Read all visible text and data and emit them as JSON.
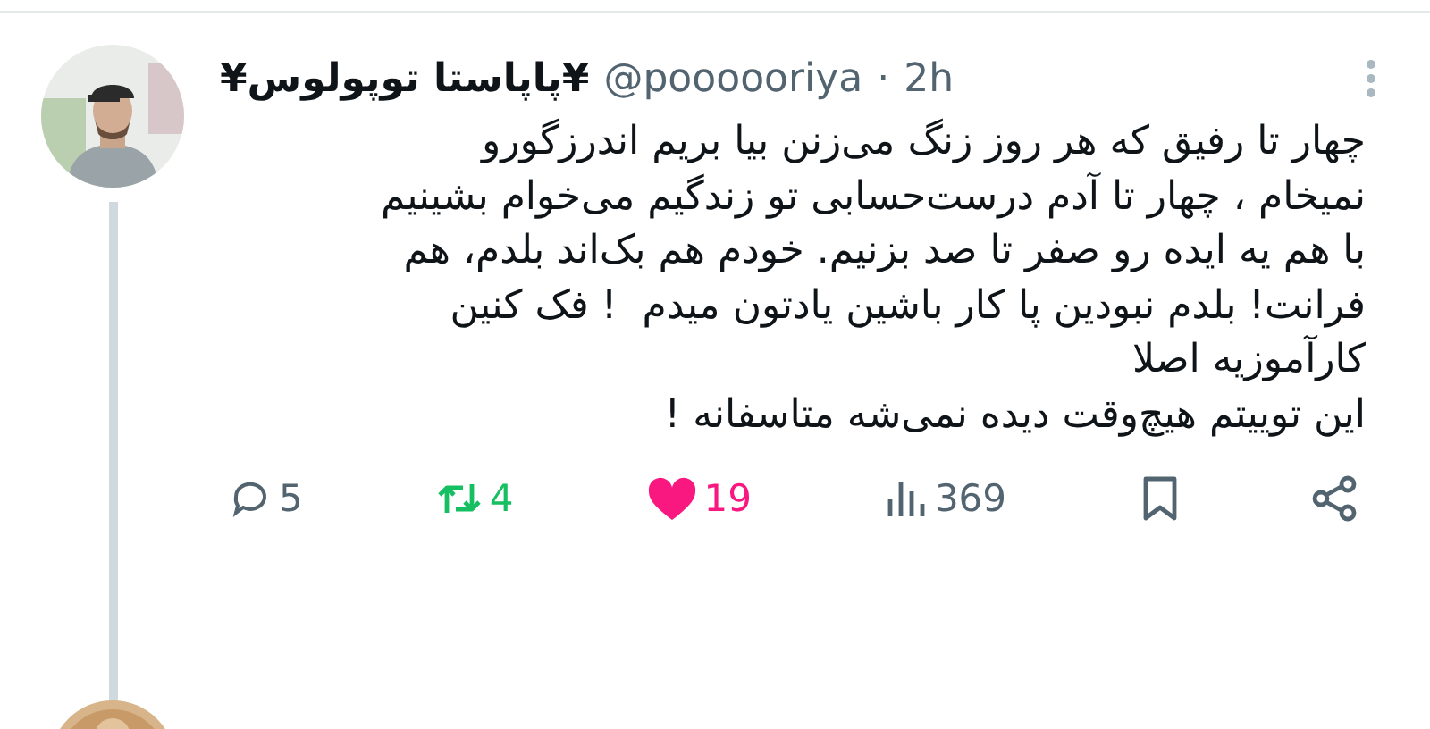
{
  "tweet": {
    "display_name": "¥پاپاستا توپولوس¥",
    "handle": "@poooooriya",
    "separator": "·",
    "time": "2h",
    "text": "چهار تا رفیق که هر روز زنگ می‌زنن بیا بریم اندرزگورو\nنمیخام ، چهار تا آدم درست‌حسابی تو زندگیم می‌خوام بشینیم\nبا هم یه ایده رو صفر تا صد بزنیم. خودم هم بک‌اند بلدم، هم\nفرانت! بلدم نبودین پا کار باشین یادتون میدم  ! فک کنین\nکارآموزیه اصلا\nاین توییتم هیچ‌وقت دیده نمی‌شه متاسفانه !",
    "actions": {
      "reply": {
        "count": "5",
        "selected": false
      },
      "retweet": {
        "count": "4",
        "selected": true
      },
      "like": {
        "count": "19",
        "selected": true
      },
      "views": {
        "count": "369"
      },
      "bookmark": {
        "selected": false
      }
    }
  }
}
